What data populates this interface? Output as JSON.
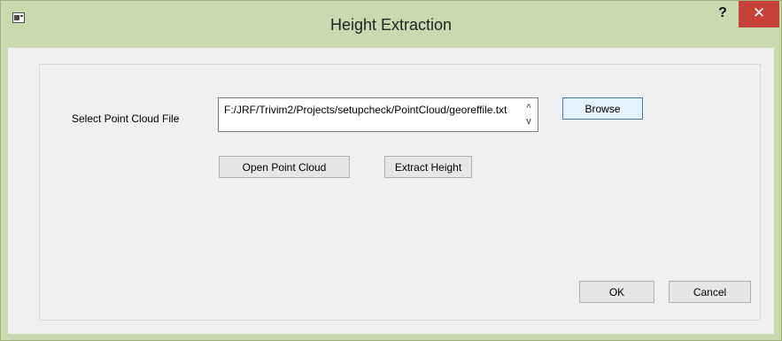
{
  "window": {
    "title": "Height Extraction",
    "help_glyph": "?",
    "close_glyph": "✕",
    "icon": "app-window-icon"
  },
  "form": {
    "file_label": "Select Point Cloud File",
    "file_path": "F:/JRF/Trivim2/Projects/setupcheck/PointCloud/georeffile.txt",
    "scroll_up_glyph": "^",
    "scroll_down_glyph": "v"
  },
  "buttons": {
    "browse": "Browse",
    "open_point_cloud": "Open Point Cloud",
    "extract_height": "Extract Height",
    "ok": "OK",
    "cancel": "Cancel"
  },
  "colors": {
    "titlebar": "#c9d9b0",
    "close": "#c7403a",
    "client": "#f0f0f0",
    "focus_border": "#3c7fb1"
  }
}
